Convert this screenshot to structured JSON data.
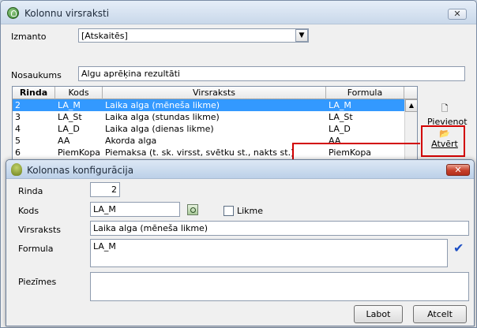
{
  "main": {
    "title": "Kolonnu virsraksti",
    "close_glyph": "✕",
    "izmanto_label": "Izmanto",
    "izmanto_value": "[Atskaitēs]",
    "nosaukums_label": "Nosaukums",
    "nosaukums_value": "Algu aprēķina rezultāti",
    "columns": [
      "Rinda",
      "Kods",
      "Virsraksts",
      "Formula"
    ],
    "rows": [
      {
        "rinda": "2",
        "kods": "LA_M",
        "virsraksts": "Laika alga (mēneša likme)",
        "formula": "LA_M",
        "selected": true
      },
      {
        "rinda": "3",
        "kods": "LA_St",
        "virsraksts": "Laika alga (stundas likme)",
        "formula": "LA_St"
      },
      {
        "rinda": "4",
        "kods": "LA_D",
        "virsraksts": "Laika alga (dienas likme)",
        "formula": "LA_D"
      },
      {
        "rinda": "5",
        "kods": "AA",
        "virsraksts": "Akorda alga",
        "formula": "AA"
      },
      {
        "rinda": "6",
        "kods": "PiemKopa",
        "virsraksts": "Piemaksa (t. sk. virsst, svētku st., nakts st.)",
        "formula": "PiemKopa"
      }
    ],
    "pievienot_label": "Pievienot",
    "atvert_label": "Atvērt",
    "highlight_color": "#d20000",
    "selection_color": "#3399ff"
  },
  "dialog": {
    "title": "Kolonnas konfigurācija",
    "close_glyph": "✕",
    "rinda_label": "Rinda",
    "rinda_value": "2",
    "kods_label": "Kods",
    "kods_value": "LA_M",
    "likme_label": "Likme",
    "likme_checked": false,
    "virsraksts_label": "Virsraksts",
    "virsraksts_value": "Laika alga (mēneša likme)",
    "formula_label": "Formula",
    "formula_value": "LA_M",
    "piezimes_label": "Piezīmes",
    "piezimes_value": "",
    "labot_label": "Labot",
    "atcelt_label": "Atcelt",
    "check_glyph": "✔"
  }
}
